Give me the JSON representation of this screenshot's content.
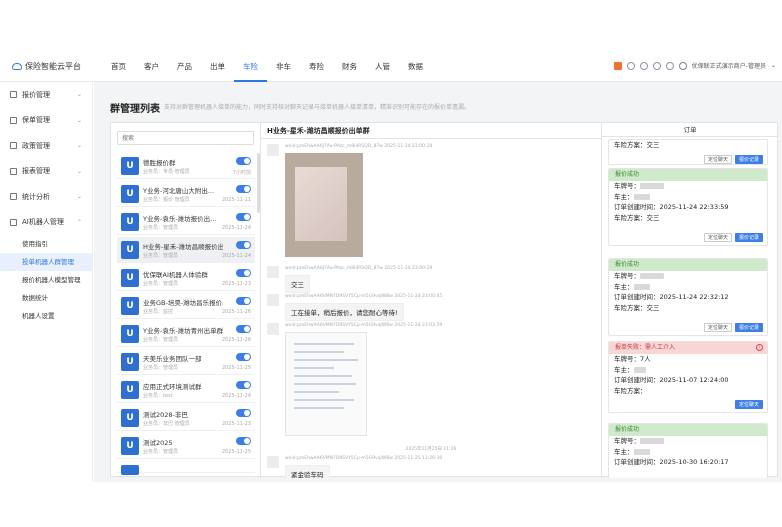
{
  "app": {
    "logo_text": "保险智能云平台"
  },
  "nav": [
    "首页",
    "客户",
    "产品",
    "出单",
    "车险",
    "非车",
    "寿险",
    "财务",
    "人管",
    "数据"
  ],
  "nav_active": "车险",
  "user": {
    "name": "优保联正式演示商户-管理员"
  },
  "sidebar": {
    "groups": [
      "报价管理",
      "保单管理",
      "政策管理",
      "报表管理",
      "统计分析",
      "AI机器人管理"
    ],
    "sub_items": [
      "使用指引",
      "投单机器人群管理",
      "报价机器人模型管理",
      "数据统计",
      "机器人设置"
    ],
    "active_sub": "投单机器人群管理"
  },
  "page": {
    "title": "群管理列表",
    "desc": "支持对群管理机器人接单的能力，同时支持核对聊天记录与接单机器人接单清单，精准识别可能存在的报价单遗漏。"
  },
  "search": {
    "placeholder": "搜索"
  },
  "groups": [
    {
      "name": "德胜报价群",
      "sub": "业务员：专员·管理员",
      "date": "7小时前"
    },
    {
      "name": "Y业务-河北唐山大附出...",
      "sub": "业务员：报价·管理员",
      "date": "2025-11-11"
    },
    {
      "name": "Y业务-袁乐-潍坊报价出...",
      "sub": "业务员：管理员",
      "date": "2025-11-24"
    },
    {
      "name": "H业务-星禾-潍坊昌顺报价出...",
      "sub": "业务员：管理员",
      "date": "2025-11-24"
    },
    {
      "name": "优保联AI机器人体验群",
      "sub": "业务员：管理员",
      "date": "2025-11-23"
    },
    {
      "name": "业务GB-培昊-潍坊昌乐报价出...",
      "sub": "业务员：监控",
      "date": "2025-11-26"
    },
    {
      "name": "Y业务-袁乐-潍坊青州出单群",
      "sub": "业务员：管理员",
      "date": "2025-11-26"
    },
    {
      "name": "天美乐业务团队一部",
      "sub": "业务员：管理员",
      "date": "2025-11-25"
    },
    {
      "name": "应用正式环境测试群",
      "sub": "业务员：test",
      "date": "2025-11-24"
    },
    {
      "name": "测试2028-非巴",
      "sub": "业务员：非巴·管理员",
      "date": "2025-11-23"
    },
    {
      "name": "测试2025",
      "sub": "业务员：管理员",
      "date": "2025-11-25"
    }
  ],
  "chat": {
    "title": "H业务-星禾-潍坊昌顺报价出单群",
    "messages": [
      {
        "meta": "wxid:pmEhwAA6J7Ax-PAzc_m8I4RSQD_87w   2025-11-24 23:00:28",
        "text": ""
      },
      {
        "meta": "wxid:pmEhwAA6J7Ax-PAzc_m8I4RSQD_87w   2025-11-24 23:00:29",
        "text": "交三"
      },
      {
        "meta": "wxid:pmEhwAA6VMN7D9SVY5Cp-m5G9vaJWBw   2025-11-24 23:00:45",
        "text": "工在接单，稍后报价，请您耐心等待!"
      },
      {
        "meta": "wxid:pmEhwAA6VMN7D9SVY5Cp-m5G9vaJWBw   2025-11-24 23:03:59",
        "text": ""
      },
      {
        "meta": "wxid:pmEhwAA6VMN7D9SVY5Cp-m5G9vaJWBw   2025-11-25 11:26:30",
        "text": "紧金验车码"
      }
    ],
    "time_sep": "2025年11月25日 11:26"
  },
  "orders": {
    "header": "订单",
    "btn_locate": "定位聊天",
    "btn_quote": "报价记录",
    "cards": [
      {
        "status": "",
        "rows": [
          "车险方案：交三"
        ]
      },
      {
        "status": "报价成功",
        "rows": [
          "车牌号：",
          "车主：",
          "订单创建时间：2025-11-24 22:33:59",
          "车险方案：交三"
        ]
      },
      {
        "status": "报价成功",
        "rows": [
          "车牌号：",
          "车主：",
          "订单创建时间：2025-11-24 22:32:12",
          "车险方案：交三"
        ]
      },
      {
        "status": "报单失败：需人工介入",
        "rows": [
          "车牌号：7人",
          "车主：",
          "订单创建时间：2025-11-07 12:24:00",
          "车险方案："
        ]
      },
      {
        "status": "报价成功",
        "rows": [
          "车牌号：",
          "车主：",
          "订单创建时间：2025-10-30 16:20:17"
        ]
      }
    ]
  }
}
